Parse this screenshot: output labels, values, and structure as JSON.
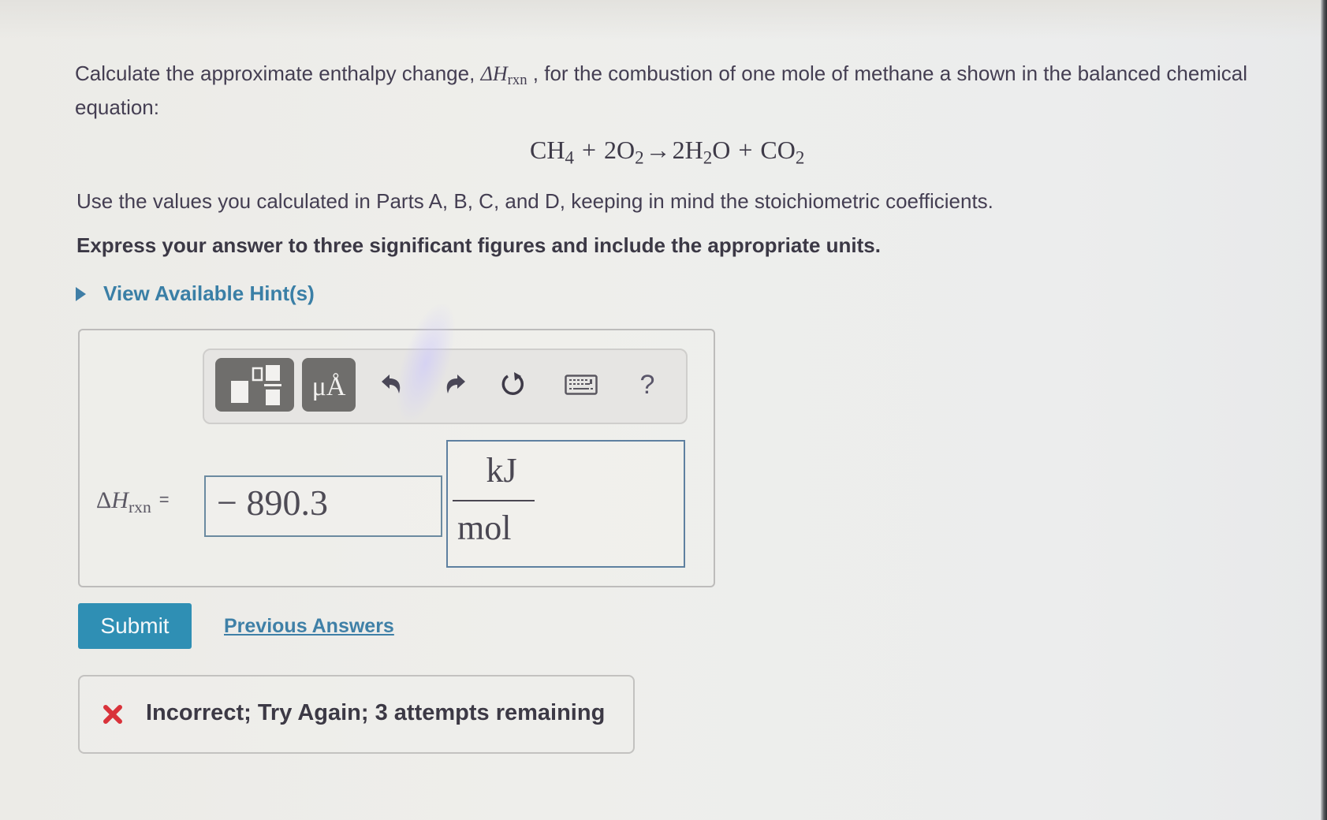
{
  "question": {
    "prompt_before": "Calculate the approximate enthalpy change, ",
    "prompt_symbol": "ΔH",
    "prompt_symbol_sub": "rxn",
    "prompt_after": " , for the combustion of one mole of methane a shown in the balanced chemical equation:",
    "equation": {
      "reactant1": "CH",
      "reactant1_sub": "4",
      "plus1": "+",
      "reactant2": "2O",
      "reactant2_sub": "2",
      "arrow": "→",
      "product1": "2H",
      "product1_sub": "2",
      "product1_tail": "O",
      "plus2": "+",
      "product2": "CO",
      "product2_sub": "2"
    },
    "instruction": "Use the values you calculated in Parts A, B, C, and D, keeping in mind the stoichiometric coefficients.",
    "format_instruction": "Express your answer to three significant figures and include the appropriate units."
  },
  "hints": {
    "label": "View Available Hint(s)",
    "icon": "triangle-right-icon"
  },
  "toolbar": {
    "buttons": [
      {
        "name": "templates",
        "icon": "templates-icon"
      },
      {
        "name": "units",
        "label": "μÅ",
        "icon": "units-icon"
      },
      {
        "name": "undo",
        "icon": "undo-icon"
      },
      {
        "name": "redo",
        "icon": "redo-icon"
      },
      {
        "name": "reset",
        "icon": "reset-icon"
      },
      {
        "name": "keyboard",
        "icon": "keyboard-icon"
      },
      {
        "name": "help",
        "label": "?",
        "icon": "help-icon"
      }
    ]
  },
  "answer": {
    "label_symbol": "ΔH",
    "label_sub": "rxn",
    "label_equals": "=",
    "value": "− 890.3",
    "unit_numerator": "kJ",
    "unit_denominator": "mol"
  },
  "actions": {
    "submit_label": "Submit",
    "previous_answers_label": "Previous Answers"
  },
  "feedback": {
    "status": "incorrect",
    "icon": "x-icon",
    "message": "Incorrect; Try Again; 3 attempts remaining",
    "color": "#d9323a"
  },
  "colors": {
    "accent": "#2f8fb4",
    "link": "#3f80a7",
    "toolbar_button": "#6f6e6c",
    "error": "#d9323a"
  }
}
